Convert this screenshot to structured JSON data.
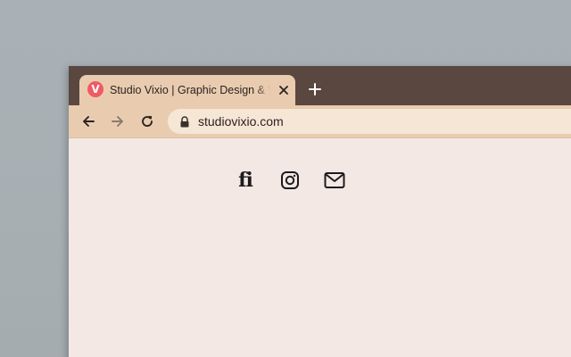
{
  "browser": {
    "tab": {
      "title": "Studio Vixio | Graphic Design & Web Design",
      "favicon_letter": "V",
      "favicon_color": "#f05a64",
      "close_icon": "close-icon"
    },
    "new_tab_icon": "plus-icon",
    "nav": {
      "back_icon": "arrow-left-icon",
      "forward_icon": "arrow-right-icon",
      "reload_icon": "reload-icon"
    },
    "address_bar": {
      "url": "studiovixio.com",
      "secure_icon": "lock-icon"
    },
    "colors": {
      "frame": "#5a4740",
      "toolbar": "#e9ccb0",
      "page_background": "#f4e8e5"
    }
  },
  "page": {
    "social_links": [
      {
        "name": "fi-logo-icon",
        "glyph": "fi"
      },
      {
        "name": "instagram-icon"
      },
      {
        "name": "mail-icon"
      }
    ]
  }
}
